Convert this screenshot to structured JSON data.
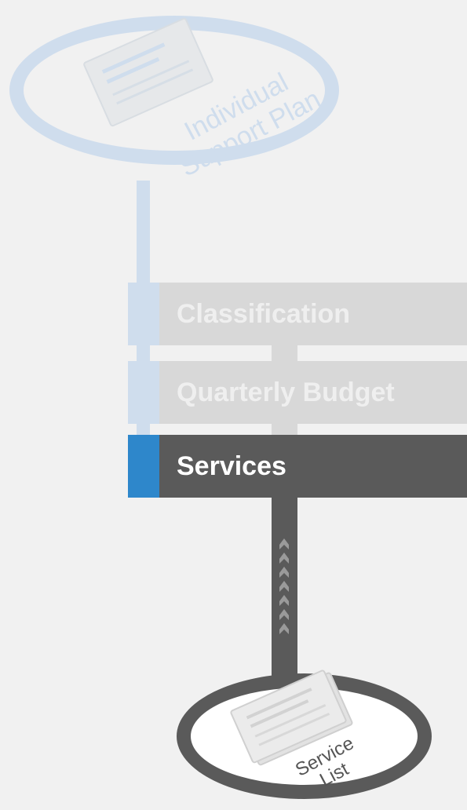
{
  "diagram": {
    "top_node": {
      "label_line1": "Individual",
      "label_line2": "Support Plan",
      "icon": "document-icon"
    },
    "steps": [
      {
        "label": "Classification",
        "state": "inactive"
      },
      {
        "label": "Quarterly Budget",
        "state": "inactive"
      },
      {
        "label": "Services",
        "state": "active"
      }
    ],
    "bottom_node": {
      "label_line1": "Service",
      "label_line2": "List",
      "icon": "document-icon"
    },
    "connector_icon": "up-chevrons-icon",
    "colors": {
      "background": "#f1f1f1",
      "inactive_blue": "#cfdded",
      "inactive_gray": "#d8d8d8",
      "active_blue": "#2e87cb",
      "active_dark": "#5a5a5a",
      "active_text": "#ffffff"
    }
  }
}
